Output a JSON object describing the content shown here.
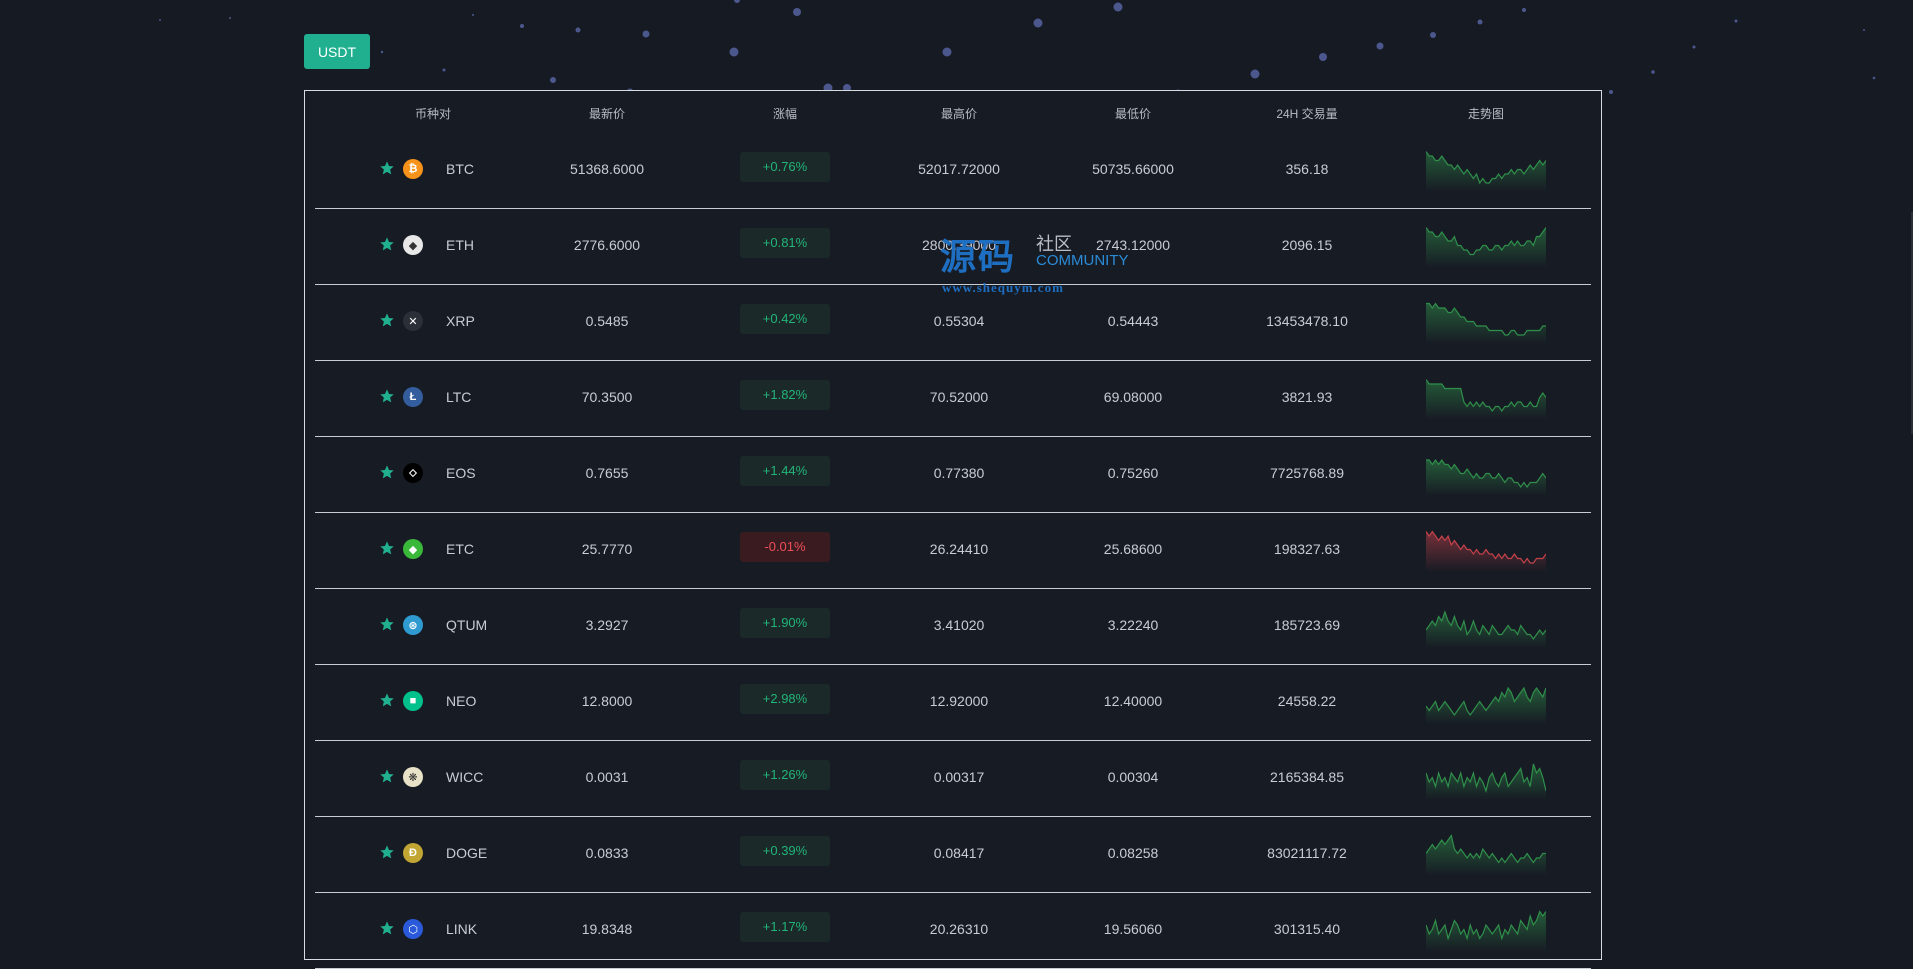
{
  "market_tab": {
    "label": "USDT"
  },
  "columns": [
    "币种对",
    "最新价",
    "涨幅",
    "最高价",
    "最低价",
    "24H 交易量",
    "走势图"
  ],
  "rows": [
    {
      "symbol": "BTC",
      "icon": "btc-icon",
      "icon_color": "#f7931a",
      "icon_glyph": "₿",
      "price": "51368.6000",
      "change": "+0.76%",
      "high": "52017.72000",
      "low": "50735.66000",
      "volume": "356.18",
      "trend": "up",
      "spark": [
        9,
        8,
        8,
        7,
        7,
        8,
        7,
        6,
        6,
        5,
        6,
        5,
        4,
        5,
        4,
        3,
        4,
        2,
        3,
        2,
        2,
        3,
        3,
        4,
        3,
        4,
        4,
        5,
        4,
        5,
        5,
        4,
        5,
        6,
        5,
        6,
        7,
        6,
        7
      ]
    },
    {
      "symbol": "ETH",
      "icon": "eth-icon",
      "icon_color": "#e8e8e8",
      "icon_glyph": "◆",
      "price": "2776.6000",
      "change": "+0.81%",
      "high": "2800.39000",
      "low": "2743.12000",
      "volume": "2096.15",
      "trend": "up",
      "spark": [
        9,
        8,
        8,
        7,
        7,
        8,
        7,
        6,
        6,
        7,
        5,
        5,
        4,
        4,
        3,
        3,
        4,
        4,
        5,
        5,
        4,
        4,
        5,
        5,
        4,
        5,
        5,
        6,
        5,
        6,
        5,
        5,
        6,
        6,
        5,
        7,
        7,
        8,
        9
      ]
    },
    {
      "symbol": "XRP",
      "icon": "xrp-icon",
      "icon_color": "#2b2f38",
      "icon_glyph": "✕",
      "price": "0.5485",
      "change": "+0.42%",
      "high": "0.55304",
      "low": "0.54443",
      "volume": "13453478.10",
      "trend": "up",
      "spark": [
        9,
        9,
        8,
        9,
        8,
        8,
        8,
        7,
        7,
        8,
        7,
        6,
        6,
        5,
        5,
        5,
        4,
        4,
        4,
        4,
        3,
        3,
        3,
        3,
        3,
        2,
        2,
        3,
        3,
        2,
        2,
        2,
        3,
        3,
        3,
        3,
        3,
        4,
        4
      ]
    },
    {
      "symbol": "LTC",
      "icon": "ltc-icon",
      "icon_color": "#345d9d",
      "icon_glyph": "Ł",
      "price": "70.3500",
      "change": "+1.82%",
      "high": "70.52000",
      "low": "69.08000",
      "volume": "3821.93",
      "trend": "up",
      "spark": [
        9,
        8,
        8,
        8,
        8,
        8,
        7,
        7,
        7,
        7,
        7,
        7,
        4,
        3,
        4,
        3,
        4,
        3,
        4,
        3,
        3,
        2,
        3,
        3,
        2,
        3,
        3,
        4,
        3,
        4,
        4,
        3,
        3,
        4,
        3,
        3,
        5,
        6,
        5
      ]
    },
    {
      "symbol": "EOS",
      "icon": "eos-icon",
      "icon_color": "#000000",
      "icon_glyph": "⬦",
      "price": "0.7655",
      "change": "+1.44%",
      "high": "0.77380",
      "low": "0.75260",
      "volume": "7725768.89",
      "trend": "up",
      "spark": [
        8,
        8,
        7,
        8,
        7,
        8,
        7,
        7,
        6,
        7,
        6,
        5,
        5,
        6,
        5,
        4,
        5,
        4,
        4,
        5,
        5,
        4,
        4,
        5,
        4,
        3,
        4,
        4,
        3,
        3,
        2,
        3,
        2,
        3,
        3,
        3,
        4,
        5,
        4
      ]
    },
    {
      "symbol": "ETC",
      "icon": "etc-icon",
      "icon_color": "#3ab83a",
      "icon_glyph": "◆",
      "price": "25.7770",
      "change": "-0.01%",
      "high": "26.24410",
      "low": "25.68600",
      "volume": "198327.63",
      "trend": "down",
      "spark": [
        9,
        8,
        9,
        8,
        7,
        8,
        7,
        8,
        6,
        7,
        6,
        5,
        6,
        5,
        5,
        4,
        5,
        4,
        4,
        5,
        4,
        4,
        3,
        4,
        3,
        4,
        3,
        3,
        4,
        3,
        3,
        2,
        3,
        2,
        2,
        3,
        3,
        3,
        4
      ]
    },
    {
      "symbol": "QTUM",
      "icon": "qtum-icon",
      "icon_color": "#2e9ad0",
      "icon_glyph": "⊛",
      "price": "3.2927",
      "change": "+1.90%",
      "high": "3.41020",
      "low": "3.22240",
      "volume": "185723.69",
      "trend": "up",
      "spark": [
        4,
        5,
        6,
        5,
        7,
        6,
        8,
        6,
        5,
        7,
        5,
        4,
        6,
        3,
        4,
        6,
        4,
        3,
        5,
        4,
        3,
        5,
        4,
        3,
        3,
        4,
        5,
        4,
        4,
        3,
        5,
        4,
        3,
        3,
        2,
        3,
        4,
        3,
        4
      ]
    },
    {
      "symbol": "NEO",
      "icon": "neo-icon",
      "icon_color": "#00c08b",
      "icon_glyph": "■",
      "price": "12.8000",
      "change": "+2.98%",
      "high": "12.92000",
      "low": "12.40000",
      "volume": "24558.22",
      "trend": "up",
      "spark": [
        4,
        3,
        4,
        5,
        3,
        4,
        5,
        4,
        3,
        2,
        3,
        4,
        5,
        3,
        2,
        3,
        4,
        5,
        4,
        3,
        4,
        5,
        6,
        5,
        7,
        6,
        8,
        7,
        5,
        6,
        7,
        8,
        6,
        5,
        7,
        8,
        7,
        6,
        8
      ]
    },
    {
      "symbol": "WICC",
      "icon": "wicc-icon",
      "icon_color": "#e8e2c8",
      "icon_glyph": "❋",
      "price": "0.0031",
      "change": "+1.26%",
      "high": "0.00317",
      "low": "0.00304",
      "volume": "2165384.85",
      "trend": "up",
      "spark": [
        6,
        4,
        5,
        3,
        6,
        4,
        5,
        3,
        6,
        5,
        4,
        6,
        3,
        5,
        4,
        6,
        3,
        5,
        4,
        2,
        5,
        6,
        4,
        3,
        5,
        6,
        3,
        4,
        5,
        6,
        7,
        4,
        5,
        3,
        8,
        6,
        7,
        5,
        2
      ]
    },
    {
      "symbol": "DOGE",
      "icon": "doge-icon",
      "icon_color": "#c2a633",
      "icon_glyph": "Ð",
      "price": "0.0833",
      "change": "+0.39%",
      "high": "0.08417",
      "low": "0.08258",
      "volume": "83021117.72",
      "trend": "up",
      "spark": [
        5,
        6,
        7,
        6,
        7,
        8,
        7,
        8,
        9,
        6,
        5,
        6,
        5,
        4,
        5,
        4,
        5,
        4,
        6,
        5,
        4,
        5,
        4,
        3,
        4,
        3,
        4,
        5,
        4,
        3,
        4,
        4,
        5,
        4,
        3,
        4,
        4,
        5,
        5
      ]
    },
    {
      "symbol": "LINK",
      "icon": "link-icon",
      "icon_color": "#2a5ada",
      "icon_glyph": "⬡",
      "price": "19.8348",
      "change": "+1.17%",
      "high": "20.26310",
      "low": "19.56060",
      "volume": "301315.40",
      "trend": "up",
      "spark": [
        6,
        4,
        5,
        7,
        4,
        5,
        6,
        3,
        5,
        7,
        6,
        4,
        5,
        3,
        6,
        4,
        5,
        3,
        4,
        6,
        5,
        4,
        5,
        6,
        3,
        5,
        4,
        6,
        5,
        4,
        7,
        6,
        5,
        8,
        6,
        7,
        9,
        8,
        9
      ]
    }
  ],
  "watermark": {
    "main": "源码",
    "sub1": "社区",
    "sub2": "COMMUNITY",
    "url": "www.shequym.com"
  },
  "colors": {
    "accent": "#20b090",
    "up": "#22b47a",
    "down": "#ef4d58",
    "up_line": "#2f8f4a",
    "down_line": "#c4414a"
  },
  "favorite_icon": "star-icon"
}
